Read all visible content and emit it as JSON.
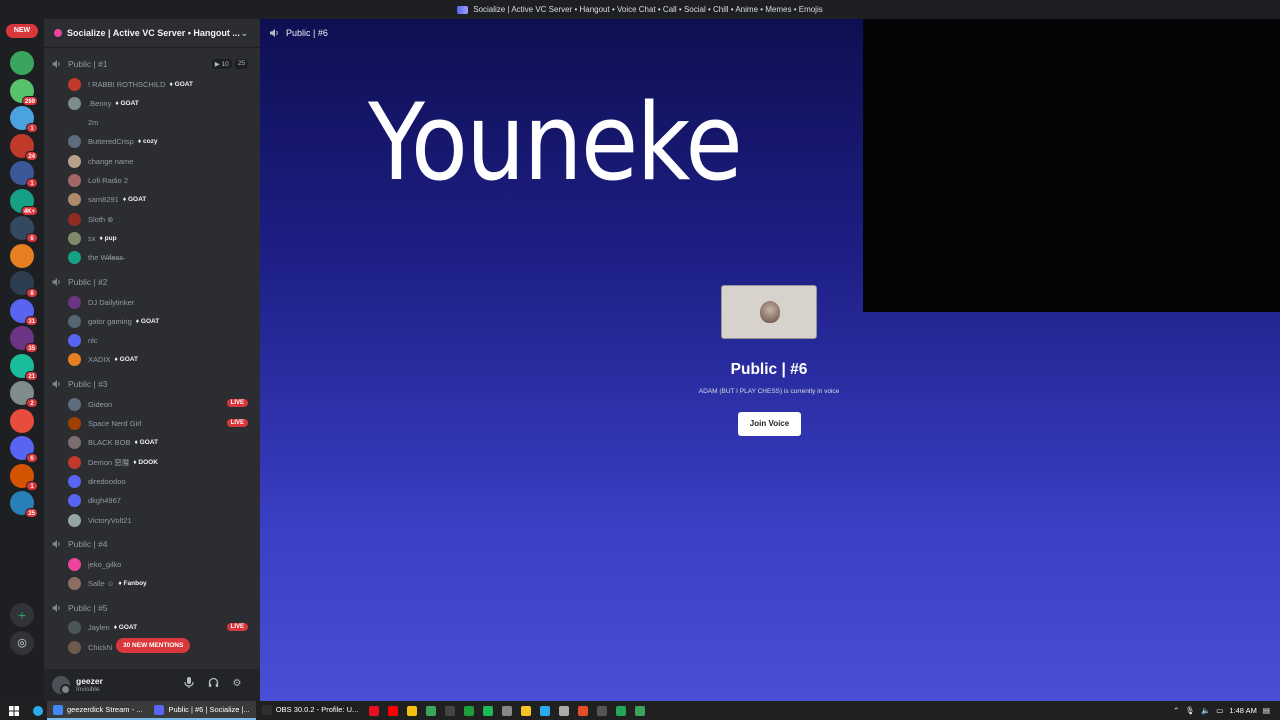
{
  "window_title": "Socialize | Active VC Server • Hangout • Voice Chat • Call • Social • Chill • Anime • Memes • Emojis",
  "rail": {
    "new_label": "NEW",
    "badges": [
      "",
      "269",
      "1",
      "24",
      "1",
      "4K+",
      "6",
      "",
      "8",
      "31",
      "35",
      "21",
      "2",
      "",
      "6",
      "1",
      "25"
    ]
  },
  "server": {
    "name": "Socialize | Active VC Server • Hangout ..."
  },
  "channels": [
    {
      "name": "Public | #1",
      "video_count": "10",
      "user_count": "25",
      "members": [
        {
          "name": "! RABBI ROTHSCHILD",
          "tag": "GOAT",
          "color": "#c0392b"
        },
        {
          "name": ".Benny",
          "tag": "GOAT",
          "color": "#7f8c8d"
        },
        {
          "name": "2m",
          "tag": "",
          "color": "#2b2d31"
        },
        {
          "name": "ButteredCrisp",
          "tag": "cozy",
          "color": "#5d6d7e"
        },
        {
          "name": "change name",
          "tag": "",
          "color": "#b9a089"
        },
        {
          "name": "Lofi Radio 2",
          "tag": "",
          "color": "#a26769"
        },
        {
          "name": "sam8291",
          "tag": "GOAT",
          "color": "#b08968"
        },
        {
          "name": "Sloth ⊗",
          "tag": "",
          "color": "#922b21"
        },
        {
          "name": "sx",
          "tag": "pup",
          "color": "#7d8b6a"
        },
        {
          "name": "the W̶i̶f̶e̶s̶s̶",
          "tag": "",
          "color": "#16a085"
        }
      ]
    },
    {
      "name": "Public | #2",
      "members": [
        {
          "name": "DJ Dailytinker",
          "tag": "",
          "color": "#6c3483"
        },
        {
          "name": "gator gaming",
          "tag": "GOAT",
          "color": "#566573"
        },
        {
          "name": "nlc",
          "tag": "",
          "color": "#5865f2"
        },
        {
          "name": "XADIX",
          "tag": "GOAT",
          "color": "#e67e22"
        }
      ]
    },
    {
      "name": "Public | #3",
      "members": [
        {
          "name": "Gideon",
          "tag": "",
          "color": "#5d6d7e",
          "live": "LIVE"
        },
        {
          "name": "Space Nerd Girl",
          "tag": "",
          "color": "#a04000",
          "live": "LIVE"
        },
        {
          "name": "BLACK BOB",
          "tag": "GOAT",
          "color": "#7b6d6d"
        },
        {
          "name": "Demon 惡魔",
          "tag": "DOOK",
          "color": "#c0392b"
        },
        {
          "name": "diredoodoo",
          "tag": "",
          "color": "#5865f2"
        },
        {
          "name": "dkgh4967",
          "tag": "",
          "color": "#5865f2"
        },
        {
          "name": "VictoryVolt21",
          "tag": "",
          "color": "#95a5a6"
        }
      ]
    },
    {
      "name": "Public | #4",
      "members": [
        {
          "name": "jeko_gilko",
          "tag": "",
          "color": "#eb459e"
        },
        {
          "name": "Salle ☺",
          "tag": "Fanboy",
          "color": "#8d6e63"
        }
      ]
    },
    {
      "name": "Public | #5",
      "members": [
        {
          "name": "Jaylen",
          "tag": "GOAT",
          "color": "#4d5656",
          "live": "LIVE"
        },
        {
          "name": "ChickN",
          "tag": "",
          "color": "#6e5a4c"
        }
      ]
    }
  ],
  "mentions_pill": "30 NEW MENTIONS",
  "user": {
    "name": "geezer",
    "status": "Invisible"
  },
  "stage": {
    "channel": "Public | #6",
    "overlay": "Youneke",
    "card_title": "Public | #6",
    "card_sub": "ADAM (BUT I PLAY CHESS) is currently in voice",
    "join_label": "Join Voice"
  },
  "taskbar": {
    "apps": [
      {
        "label": "geezerdick Stream - ...",
        "color": "#4285f4",
        "active": true
      },
      {
        "label": "Public | #6 | Socialize |...",
        "color": "#5865f2",
        "active": true
      },
      {
        "label": "OBS 30.0.2 - Profile: U...",
        "color": "#302e31",
        "active": false
      }
    ],
    "time": "1:48 AM"
  }
}
